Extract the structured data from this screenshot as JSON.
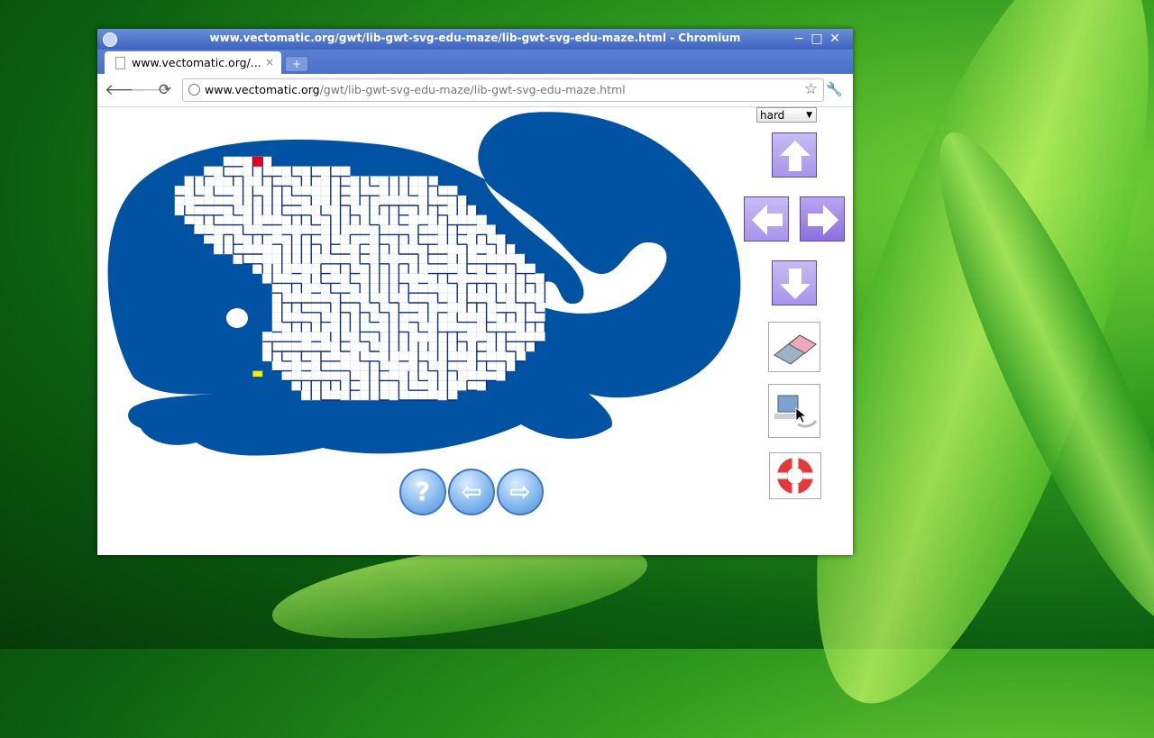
{
  "window": {
    "title": "www.vectomatic.org/gwt/lib-gwt-svg-edu-maze/lib-gwt-svg-edu-maze.html - Chromium",
    "minimize_glyph": "−",
    "maximize_glyph": "□",
    "close_glyph": "✕"
  },
  "tab": {
    "label": "www.vectomatic.org/...",
    "close_glyph": "×",
    "new_tab_glyph": "+"
  },
  "toolbar": {
    "back_glyph": "🡐",
    "forward_glyph": "🡒",
    "reload_glyph": "⟳",
    "url_domain": "www.vectomatic.org",
    "url_path": "/gwt/lib-gwt-svg-edu-maze/lib-gwt-svg-edu-maze.html",
    "star_glyph": "☆",
    "wrench_glyph": "🔧"
  },
  "game": {
    "difficulty_selected": "hard",
    "difficulty_caret": "▼",
    "help_glyph": "?",
    "prev_glyph": "⇦",
    "next_glyph": "⇨",
    "icons": {
      "up": "arrow-up-icon",
      "left": "arrow-left-icon",
      "right": "arrow-right-icon",
      "down": "arrow-down-icon",
      "erase": "eraser-icon",
      "computer": "computer-icon",
      "help": "lifebuoy-icon"
    },
    "colors": {
      "whale": "#0052a3",
      "maze_wall": "#0b2b80",
      "start_marker": "#e8001c",
      "end_marker": "#f2f200",
      "arrow_button": "#9b82e6"
    }
  }
}
